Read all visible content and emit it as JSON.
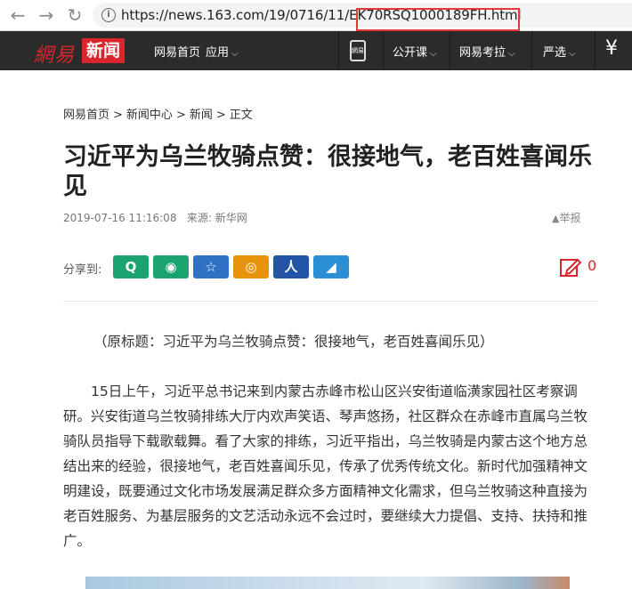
{
  "browser": {
    "url_prefix": "https://news.163.com/19/0716/11/",
    "url_highlighted": "EK70RSQ1000189FH.html",
    "back_glyph": "←",
    "forward_glyph": "→",
    "refresh_glyph": "↻",
    "info_glyph": "i"
  },
  "header": {
    "logo_left": "網易",
    "logo_right": "新闻",
    "nav": {
      "home": "网易首页",
      "apps": "应用",
      "open_course": "公开课",
      "exam": "网易考拉",
      "yanxuan": "严选",
      "phone_label": "網易",
      "yen": "¥",
      "caret": "⌵"
    }
  },
  "breadcrumb": {
    "items": [
      "网易首页",
      ">",
      "新闻中心",
      ">",
      "新闻",
      ">",
      "正文"
    ]
  },
  "article": {
    "title": "习近平为乌兰牧骑点赞：很接地气，老百姓喜闻乐见",
    "datetime": "2019-07-16 11:16:08",
    "source": "来源: 新华网",
    "report": "举报",
    "share_label": "分享到:",
    "comment_count": "0",
    "paragraph_1": "（原标题：习近平为乌兰牧骑点赞：很接地气，老百姓喜闻乐见）",
    "paragraph_2": "15日上午，习近平总书记来到内蒙古赤峰市松山区兴安街道临潢家园社区考察调研。兴安街道乌兰牧骑排练大厅内欢声笑语、琴声悠扬，社区群众在赤峰市直属乌兰牧骑队员指导下载歌载舞。看了大家的排练，习近平指出，乌兰牧骑是内蒙古这个地方总结出来的经验，很接地气，老百姓喜闻乐见，传承了优秀传统文化。新时代加强精神文明建设，既要通过文化市场发展满足群众多方面精神文化需求，但乌兰牧骑这种直接为老百姓服务、为基层服务的文艺活动永远不会过时，要继续大力提倡、支持、扶持和推广。"
  },
  "share_buttons": [
    {
      "name": "qzone-icon",
      "glyph": "Q",
      "color": "#1aa36f"
    },
    {
      "name": "wechat-icon",
      "glyph": "◉",
      "color": "#1aa36f"
    },
    {
      "name": "favorite-star-icon",
      "glyph": "☆",
      "color": "#2f72c3"
    },
    {
      "name": "weibo-icon",
      "glyph": "◎",
      "color": "#e8930c"
    },
    {
      "name": "renren-icon",
      "glyph": "人",
      "color": "#2355a6"
    },
    {
      "name": "yixin-icon",
      "glyph": "◢",
      "color": "#2b8fd6"
    }
  ],
  "colors": {
    "brand_red": "#d8262c",
    "header_bg": "#2b2b2b",
    "url_highlight": "#e53935"
  }
}
